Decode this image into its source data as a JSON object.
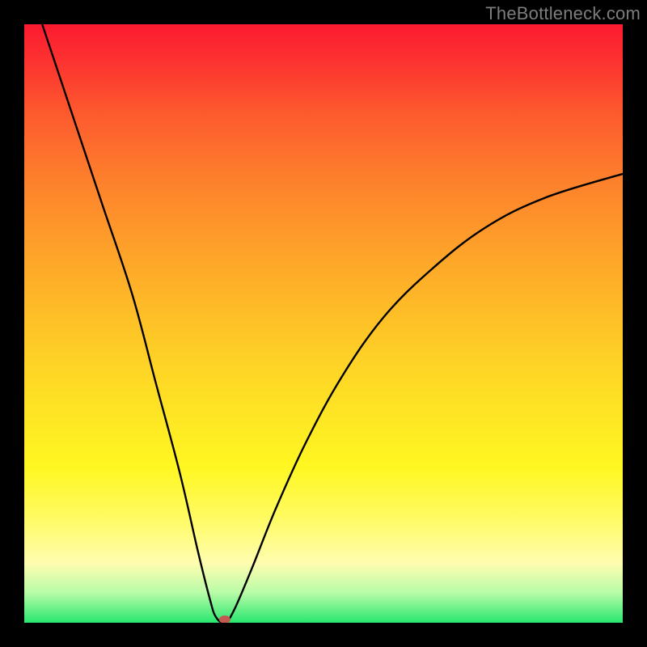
{
  "watermark": "TheBottleneck.com",
  "chart_data": {
    "type": "line",
    "title": "",
    "xlabel": "",
    "ylabel": "",
    "xlim": [
      0,
      100
    ],
    "ylim": [
      0,
      100
    ],
    "background": "rainbow-gradient red→yellow→green (top→bottom)",
    "series": [
      {
        "name": "bottleneck-curve",
        "x": [
          3,
          8,
          13,
          18,
          22,
          26,
          29,
          31,
          32,
          33.5,
          35,
          38,
          42,
          47,
          53,
          60,
          68,
          77,
          87,
          100
        ],
        "values": [
          100,
          85,
          70,
          55,
          40,
          25,
          12,
          4,
          1,
          0,
          2,
          9,
          19,
          30,
          41,
          51,
          59,
          66,
          71,
          75
        ]
      }
    ],
    "marker": {
      "x": 33.5,
      "y": 0,
      "color": "#c35a52"
    },
    "grid": false,
    "legend": false
  }
}
